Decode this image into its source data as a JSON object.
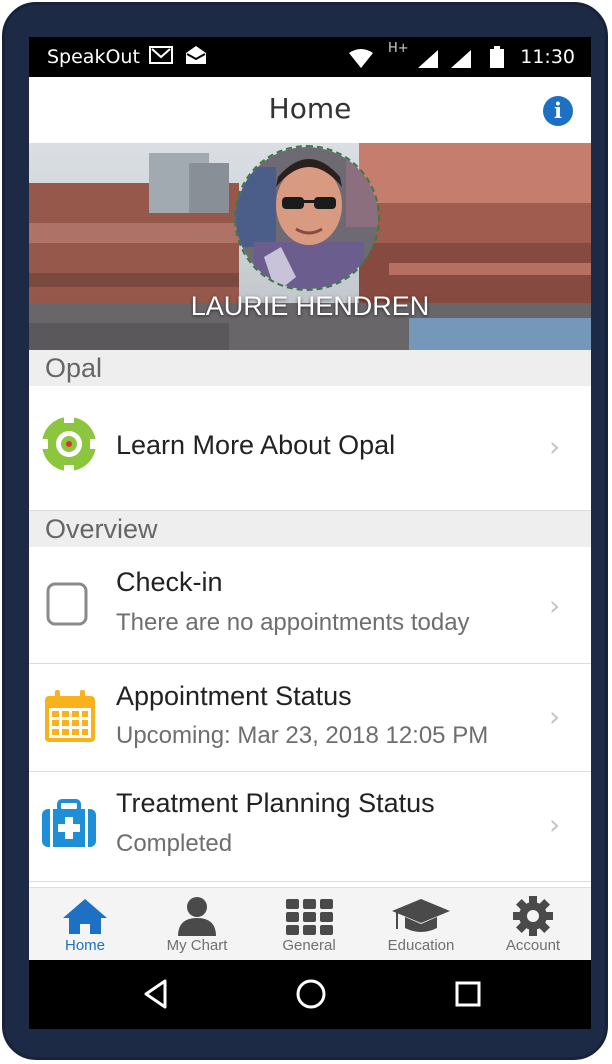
{
  "status_bar": {
    "carrier": "SpeakOut",
    "network": "H+",
    "time": "11:30"
  },
  "header": {
    "title": "Home"
  },
  "profile": {
    "name": "LAURIE HENDREN"
  },
  "sections": {
    "opal": {
      "title": "Opal",
      "items": [
        {
          "label": "Learn More About Opal",
          "icon": "opal-logo-icon"
        }
      ]
    },
    "overview": {
      "title": "Overview",
      "items": [
        {
          "label": "Check-in",
          "sub": "There are no appointments today",
          "icon": "checkbox-icon"
        },
        {
          "label": "Appointment Status",
          "sub": "Upcoming: Mar 23, 2018 12:05 PM",
          "icon": "calendar-icon"
        },
        {
          "label": "Treatment Planning Status",
          "sub": "Completed",
          "icon": "medical-kit-icon"
        }
      ]
    }
  },
  "tabs": [
    {
      "label": "Home",
      "icon": "home-icon",
      "active": true
    },
    {
      "label": "My Chart",
      "icon": "person-icon",
      "active": false
    },
    {
      "label": "General",
      "icon": "grid-icon",
      "active": false
    },
    {
      "label": "Education",
      "icon": "graduation-cap-icon",
      "active": false
    },
    {
      "label": "Account",
      "icon": "gear-icon",
      "active": false
    }
  ],
  "colors": {
    "accent": "#1d70c4",
    "opal_green": "#8cc63f",
    "calendar": "#f9b21b",
    "medical": "#1e8fd6"
  }
}
